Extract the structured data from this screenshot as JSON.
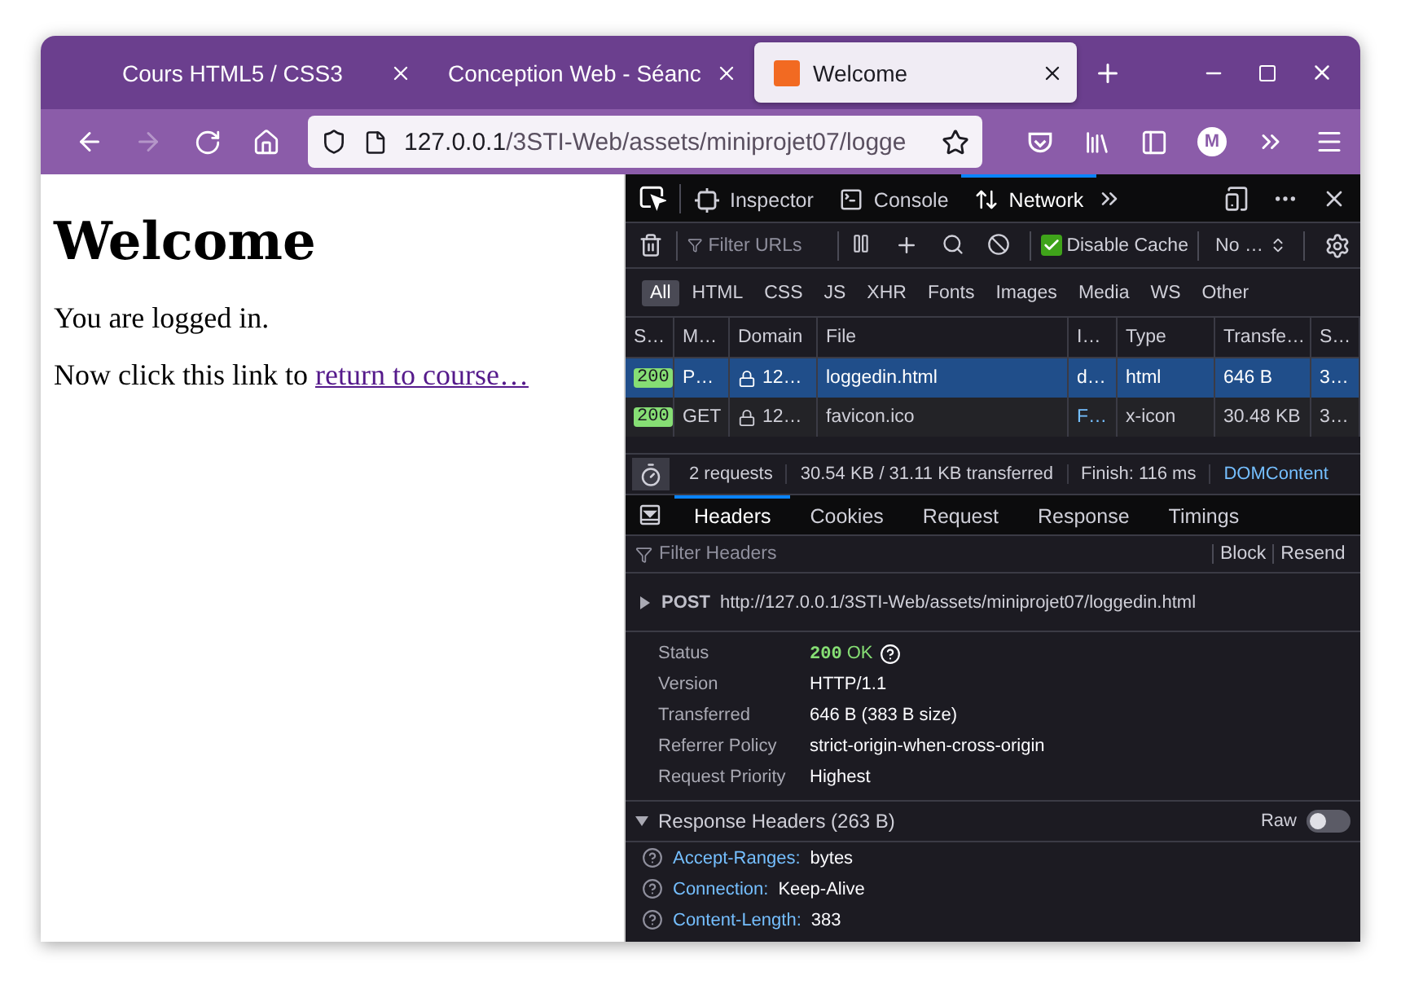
{
  "browser": {
    "tabs": [
      {
        "title": "Cours HTML5 / CSS3",
        "selected": false,
        "favicon": false
      },
      {
        "title": "Conception Web - Séanc",
        "selected": false,
        "favicon": false
      },
      {
        "title": "Welcome",
        "selected": true,
        "favicon": true
      }
    ],
    "nav_buttons": [
      {
        "kind": "back",
        "disabled": false
      },
      {
        "kind": "forward",
        "disabled": true
      },
      {
        "kind": "reload",
        "disabled": false
      },
      {
        "kind": "home",
        "disabled": false
      }
    ],
    "url": {
      "host": "127.0.0.1",
      "path": "/3STI-Web/assets/miniprojet07/logge"
    },
    "account_initial": "M"
  },
  "page": {
    "heading": "Welcome",
    "paragraphs": [
      {
        "text": "You are logged in."
      },
      {
        "text": "Now click this link to",
        "link": "return to course…"
      }
    ]
  },
  "devtools": {
    "tools": [
      {
        "label": "Inspector",
        "kind": "inspector",
        "selected": false
      },
      {
        "label": "Console",
        "kind": "console",
        "selected": false
      },
      {
        "label": "Network",
        "kind": "network",
        "selected": true
      }
    ],
    "filter": {
      "placeholder": "Filter URLs"
    },
    "disable_cache": {
      "label": "Disable Cache",
      "checked": true
    },
    "throttle": "No …",
    "type_filters": [
      {
        "label": "All",
        "selected": true
      },
      {
        "label": "HTML",
        "selected": false
      },
      {
        "label": "CSS",
        "selected": false
      },
      {
        "label": "JS",
        "selected": false
      },
      {
        "label": "XHR",
        "selected": false
      },
      {
        "label": "Fonts",
        "selected": false
      },
      {
        "label": "Images",
        "selected": false
      },
      {
        "label": "Media",
        "selected": false
      },
      {
        "label": "WS",
        "selected": false
      },
      {
        "label": "Other",
        "selected": false
      }
    ],
    "columns": [
      "S…",
      "M…",
      "Domain",
      "File",
      "I…",
      "Type",
      "Transfe…",
      "S…"
    ],
    "rows": [
      {
        "status": "200",
        "method": "P…",
        "domain": "12…",
        "file": "loggedin.html",
        "initiator": {
          "text": "d…",
          "link": false
        },
        "type": "html",
        "transferred": "646 B",
        "size": "3…",
        "selected": true
      },
      {
        "status": "200",
        "method": "GET",
        "domain": "12…",
        "file": "favicon.ico",
        "initiator": {
          "text": "F…",
          "link": true
        },
        "type": "x-icon",
        "transferred": "30.48 KB",
        "size": "3…",
        "selected": false
      }
    ],
    "status_bar": {
      "requests": "2 requests",
      "transferred": "30.54 KB / 31.11 KB transferred",
      "finish": "Finish: 116 ms",
      "dom": "DOMContent"
    },
    "detail_tabs": [
      {
        "label": "Headers",
        "selected": true
      },
      {
        "label": "Cookies",
        "selected": false
      },
      {
        "label": "Request",
        "selected": false
      },
      {
        "label": "Response",
        "selected": false
      },
      {
        "label": "Timings",
        "selected": false
      }
    ],
    "headers_filter": {
      "placeholder": "Filter Headers"
    },
    "header_actions": [
      "Block",
      "Resend"
    ],
    "request": {
      "method": "POST",
      "url": "http://127.0.0.1/3STI-Web/assets/miniprojet07/loggedin.html",
      "expanded": false
    },
    "summary": [
      {
        "label": "Status",
        "kind": "status",
        "code": "200",
        "value": "OK"
      },
      {
        "label": "Version",
        "kind": "text",
        "value": "HTTP/1.1"
      },
      {
        "label": "Transferred",
        "kind": "text",
        "value": "646 B (383 B size)"
      },
      {
        "label": "Referrer Policy",
        "kind": "text",
        "value": "strict-origin-when-cross-origin"
      },
      {
        "label": "Request Priority",
        "kind": "text",
        "value": "Highest"
      }
    ],
    "response_headers": {
      "title": "Response Headers (263 B)",
      "expanded": true,
      "raw_label": "Raw",
      "raw_on": false,
      "items": [
        {
          "name": "Accept-Ranges:",
          "value": "bytes"
        },
        {
          "name": "Connection:",
          "value": "Keep-Alive"
        },
        {
          "name": "Content-Length:",
          "value": "383"
        }
      ]
    }
  }
}
